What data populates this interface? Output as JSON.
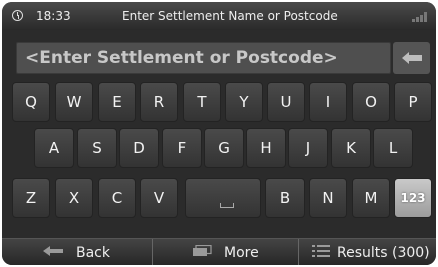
{
  "status_bar": {
    "time": "18:33",
    "title": "Enter Settlement Name or Postcode"
  },
  "search": {
    "placeholder": "<Enter Settlement or Postcode>",
    "value": ""
  },
  "keyboard": {
    "row1": [
      "Q",
      "W",
      "E",
      "R",
      "T",
      "Y",
      "U",
      "I",
      "O",
      "P"
    ],
    "row2": [
      "A",
      "S",
      "D",
      "F",
      "G",
      "H",
      "J",
      "K",
      "L"
    ],
    "row3": [
      "Z",
      "X",
      "C",
      "V",
      "",
      "B",
      "N",
      "M",
      "123"
    ]
  },
  "bottom_bar": {
    "back_label": "Back",
    "more_label": "More",
    "results_label": "Results (300)"
  }
}
